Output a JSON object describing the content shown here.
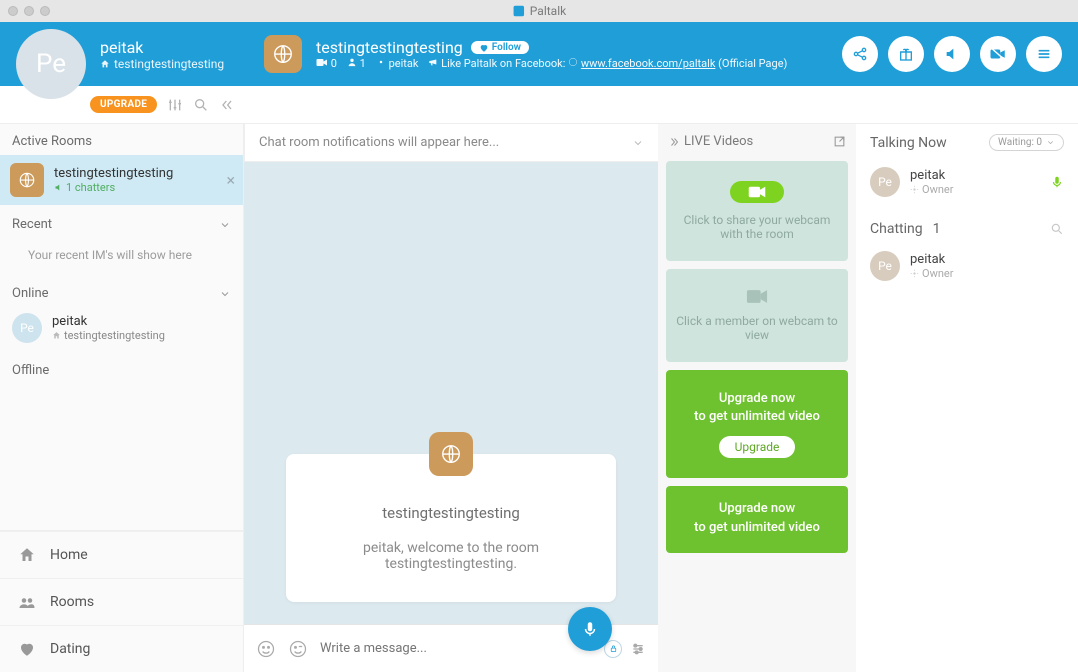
{
  "app": {
    "title": "Paltalk"
  },
  "header": {
    "user": {
      "name": "peitak",
      "avatar_initials": "Pe",
      "room": "testingtestingtesting"
    },
    "room": {
      "name": "testingtestingtesting",
      "follow_label": "Follow",
      "cam_count": "0",
      "people_count": "1",
      "admin": "peitak",
      "fb_prefix": "Like Paltalk on Facebook:",
      "fb_link": "www.facebook.com/paltalk",
      "fb_suffix": "(Official Page)"
    }
  },
  "subbar": {
    "upgrade": "UPGRADE"
  },
  "sidebar": {
    "active_rooms_label": "Active Rooms",
    "active_room": {
      "name": "testingtestingtesting",
      "chatters": "1 chatters"
    },
    "recent_label": "Recent",
    "recent_hint": "Your recent IM's will show here",
    "online_label": "Online",
    "online_user": {
      "name": "peitak",
      "room": "testingtestingtesting",
      "initials": "Pe"
    },
    "offline_label": "Offline",
    "nav": {
      "home": "Home",
      "rooms": "Rooms",
      "dating": "Dating"
    }
  },
  "center": {
    "notif": "Chat room notifications will appear here...",
    "welcome_title": "testingtestingtesting",
    "welcome_line1": "peitak, welcome to the room",
    "welcome_line2": "testingtestingtesting.",
    "compose_placeholder": "Write a message..."
  },
  "videos": {
    "header": "LIVE Videos",
    "share_text": "Click to share your webcam with the room",
    "view_text": "Click a member on webcam to view",
    "upgrade_line1": "Upgrade now",
    "upgrade_line2": "to get unlimited video",
    "upgrade_btn": "Upgrade"
  },
  "right": {
    "talking_label": "Talking Now",
    "waiting": "Waiting: 0",
    "talker": {
      "name": "peitak",
      "role": "Owner",
      "initials": "Pe"
    },
    "chatting_label": "Chatting",
    "chatting_count": "1",
    "chatter": {
      "name": "peitak",
      "role": "Owner",
      "initials": "Pe"
    }
  }
}
